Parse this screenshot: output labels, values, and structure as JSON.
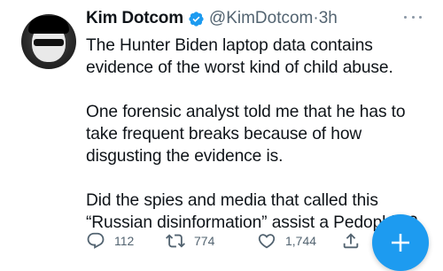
{
  "author": {
    "name": "Kim Dotcom",
    "handle": "@KimDotcom",
    "separator": "·",
    "time": "3h"
  },
  "tweet": {
    "paragraphs": [
      "The Hunter Biden laptop data contains evidence of the worst kind of child abuse.",
      "One forensic analyst told me that he has to take frequent breaks because of how disgusting the evidence is.",
      "Did the spies and media that called this “Russian disinformation” assist a Pedophile?"
    ]
  },
  "actions": {
    "replies": "112",
    "retweets": "774",
    "likes": "1,744"
  },
  "colors": {
    "accent": "#1d9bf0",
    "muted": "#536471",
    "text": "#0f1419"
  },
  "icons": [
    "verified-badge-icon",
    "more-icon",
    "reply-icon",
    "retweet-icon",
    "like-icon",
    "share-icon",
    "compose-plus-icon"
  ]
}
